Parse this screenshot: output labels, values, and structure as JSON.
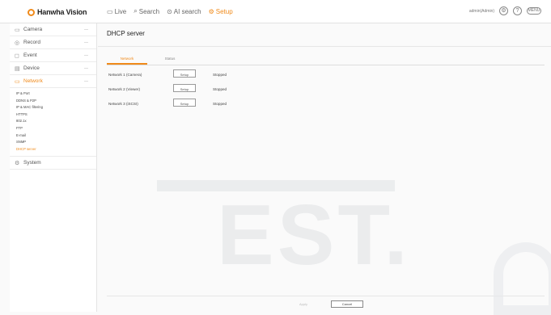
{
  "brand": {
    "name": "Hanwha Vision"
  },
  "topnav": [
    {
      "label": "Live",
      "icon": "monitor-icon",
      "active": false
    },
    {
      "label": "Search",
      "icon": "search-icon",
      "active": false
    },
    {
      "label": "AI search",
      "icon": "ai-search-icon",
      "active": false
    },
    {
      "label": "Setup",
      "icon": "gear-icon",
      "active": true
    }
  ],
  "header_right": {
    "user": "admin(Admin)",
    "icons": [
      "settings-icon",
      "help-icon"
    ],
    "pill_label": "MENU"
  },
  "sidebar": {
    "items": [
      {
        "label": "Camera",
        "icon": "camera-icon"
      },
      {
        "label": "Record",
        "icon": "record-icon"
      },
      {
        "label": "Event",
        "icon": "event-icon"
      },
      {
        "label": "Device",
        "icon": "device-icon"
      },
      {
        "label": "Network",
        "icon": "network-icon",
        "active": true
      }
    ],
    "network_sub": [
      "IP & Port",
      "DDNS & P2P",
      "IP & MAC filtering",
      "HTTPS",
      "802.1x",
      "FTP",
      "E-mail",
      "SNMP",
      "DHCP server"
    ],
    "system": {
      "label": "System",
      "icon": "system-icon"
    }
  },
  "page": {
    "title": "DHCP server"
  },
  "tabs": [
    {
      "label": "Network",
      "active": true
    },
    {
      "label": "Status",
      "active": false
    }
  ],
  "rows": [
    {
      "label": "Network 1 (Camera)",
      "button": "Setup",
      "status": "Stopped"
    },
    {
      "label": "Network 2 (Viewer)",
      "button": "Setup",
      "status": "Stopped"
    },
    {
      "label": "Network 3 (iSCSI)",
      "button": "Setup",
      "status": "Stopped"
    }
  ],
  "footer": {
    "apply": "Apply",
    "cancel": "Cancel"
  },
  "watermark": {
    "text": "EST."
  },
  "colors": {
    "accent": "#f08a1a"
  }
}
